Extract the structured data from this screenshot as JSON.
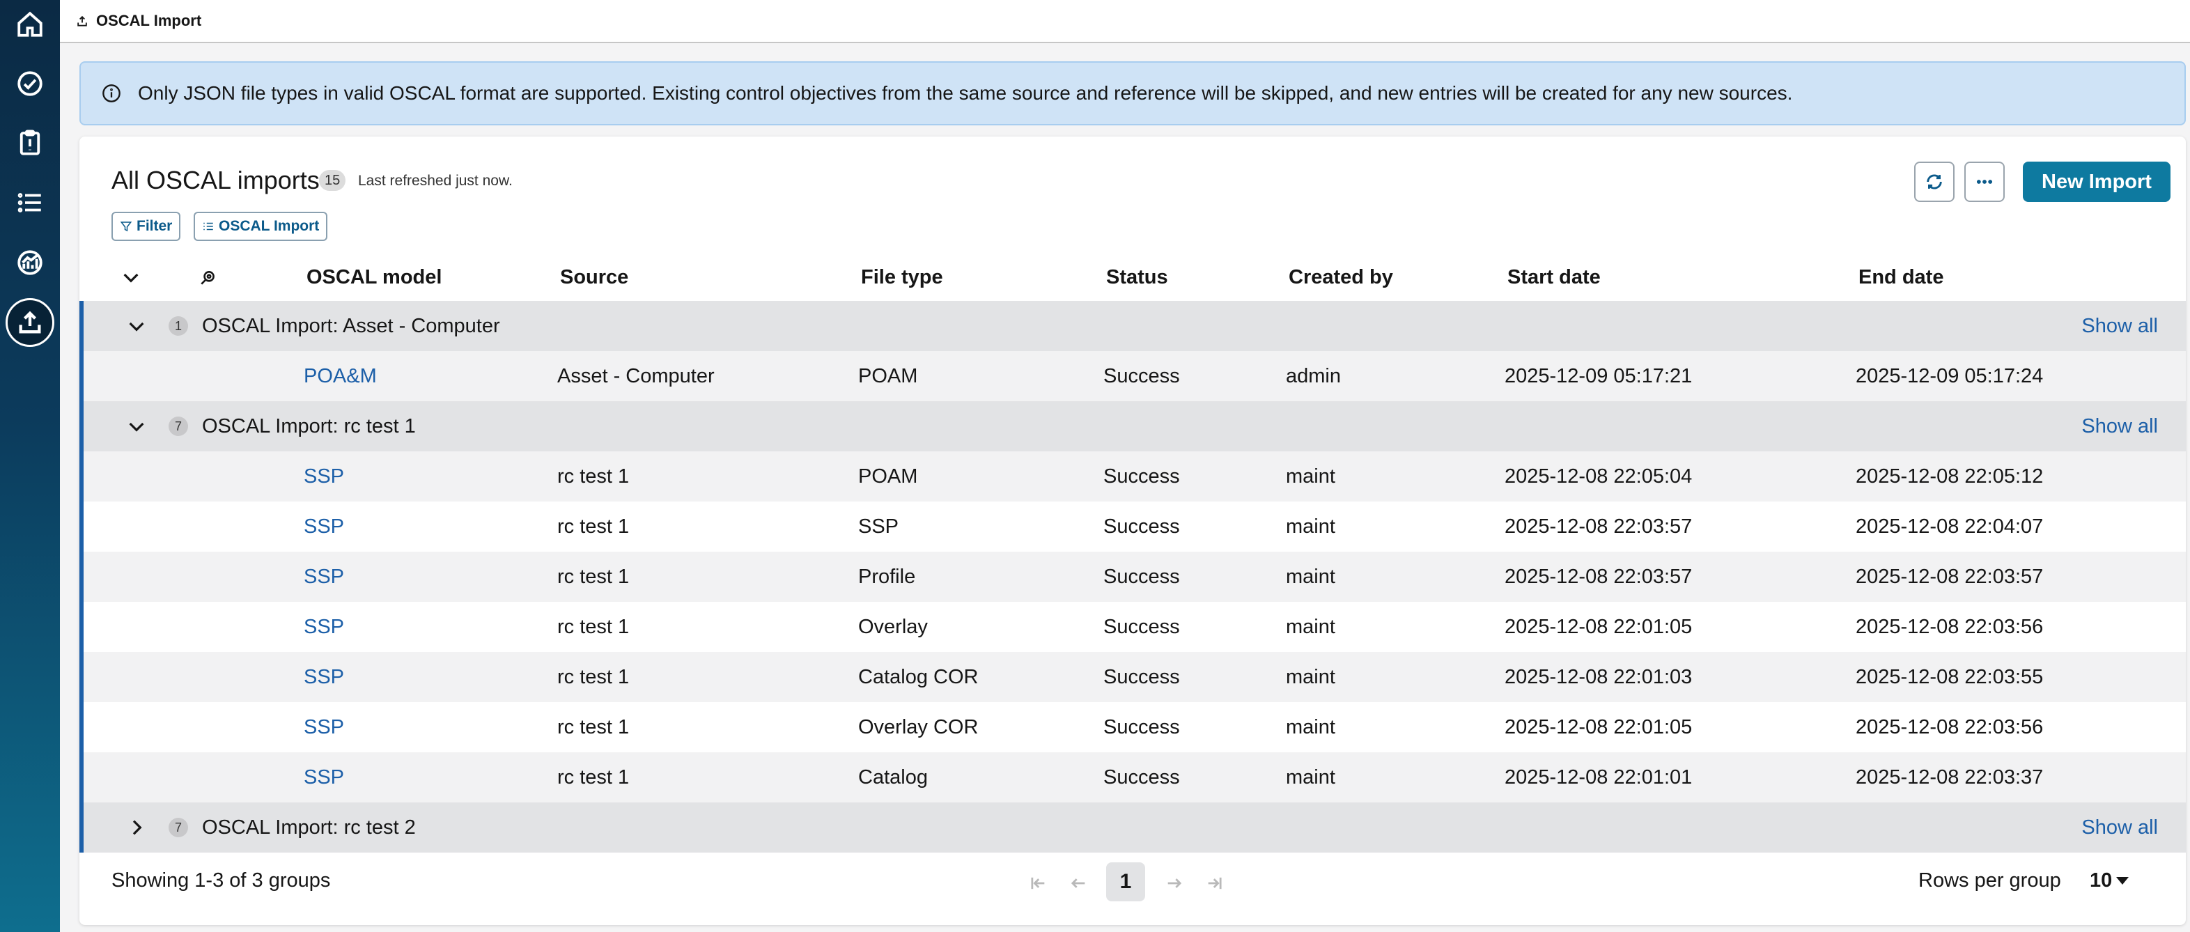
{
  "app": {
    "page_title": "OSCAL Import"
  },
  "banner": {
    "text": "Only JSON file types in valid OSCAL format are supported. Existing control objectives from the same source and reference will be skipped, and new entries will be created for any new sources."
  },
  "card": {
    "title": "All OSCAL imports",
    "count": "15",
    "refreshed": "Last refreshed just now.",
    "filter_label": "Filter",
    "group_chip_label": "OSCAL Import",
    "new_import_label": "New Import"
  },
  "columns": {
    "model": "OSCAL model",
    "source": "Source",
    "file_type": "File type",
    "status": "Status",
    "created_by": "Created by",
    "start_date": "Start date",
    "end_date": "End date"
  },
  "groups": [
    {
      "count": "1",
      "title": "OSCAL Import: Asset - Computer",
      "show_all": "Show all",
      "expanded": true,
      "rows": [
        {
          "model": "POA&M",
          "source": "Asset - Computer",
          "file_type": "POAM",
          "status": "Success",
          "created_by": "admin",
          "start": "2025-12-09 05:17:21",
          "end": "2025-12-09 05:17:24"
        }
      ]
    },
    {
      "count": "7",
      "title": "OSCAL Import: rc test 1",
      "show_all": "Show all",
      "expanded": true,
      "rows": [
        {
          "model": "SSP",
          "source": "rc test 1",
          "file_type": "POAM",
          "status": "Success",
          "created_by": "maint",
          "start": "2025-12-08 22:05:04",
          "end": "2025-12-08 22:05:12"
        },
        {
          "model": "SSP",
          "source": "rc test 1",
          "file_type": "SSP",
          "status": "Success",
          "created_by": "maint",
          "start": "2025-12-08 22:03:57",
          "end": "2025-12-08 22:04:07"
        },
        {
          "model": "SSP",
          "source": "rc test 1",
          "file_type": "Profile",
          "status": "Success",
          "created_by": "maint",
          "start": "2025-12-08 22:03:57",
          "end": "2025-12-08 22:03:57"
        },
        {
          "model": "SSP",
          "source": "rc test 1",
          "file_type": "Overlay",
          "status": "Success",
          "created_by": "maint",
          "start": "2025-12-08 22:01:05",
          "end": "2025-12-08 22:03:56"
        },
        {
          "model": "SSP",
          "source": "rc test 1",
          "file_type": "Catalog COR",
          "status": "Success",
          "created_by": "maint",
          "start": "2025-12-08 22:01:03",
          "end": "2025-12-08 22:03:55"
        },
        {
          "model": "SSP",
          "source": "rc test 1",
          "file_type": "Overlay COR",
          "status": "Success",
          "created_by": "maint",
          "start": "2025-12-08 22:01:05",
          "end": "2025-12-08 22:03:56"
        },
        {
          "model": "SSP",
          "source": "rc test 1",
          "file_type": "Catalog",
          "status": "Success",
          "created_by": "maint",
          "start": "2025-12-08 22:01:01",
          "end": "2025-12-08 22:03:37"
        }
      ]
    },
    {
      "count": "7",
      "title": "OSCAL Import: rc test 2",
      "show_all": "Show all",
      "expanded": false,
      "rows": []
    }
  ],
  "footer": {
    "showing": "Showing 1-3 of 3 groups",
    "current_page": "1",
    "rows_per_group_label": "Rows per group",
    "rows_per_group_value": "10"
  },
  "icons": {
    "nav": [
      "home-icon",
      "check-circle-icon",
      "clipboard-icon",
      "list-icon",
      "analytics-icon",
      "upload-icon"
    ]
  }
}
